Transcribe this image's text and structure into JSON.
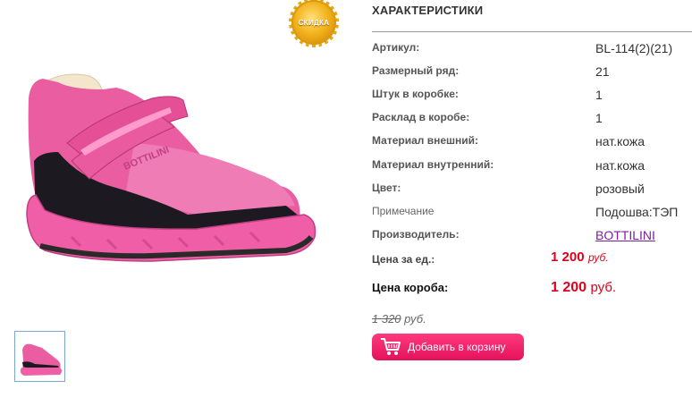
{
  "badge": {
    "label": "СКИДКА"
  },
  "specs": {
    "title": "ХАРАКТЕРИСТИКИ",
    "rows": [
      {
        "label": "Артикул:",
        "value": "BL-114(2)(21)"
      },
      {
        "label": "Размерный ряд:",
        "value": "21"
      },
      {
        "label": "Штук в коробке:",
        "value": "1"
      },
      {
        "label": "Расклад в коробе:",
        "value": "1"
      },
      {
        "label": "Материал внешний:",
        "value": "нат.кожа"
      },
      {
        "label": "Материал внутренний:",
        "value": "нат.кожа"
      },
      {
        "label": "Цвет:",
        "value": "розовый"
      },
      {
        "label": "Примечание",
        "value": "Подошва:ТЭП"
      },
      {
        "label": "Производитель:",
        "value": "BOTTILINI"
      }
    ]
  },
  "price": {
    "unit_label": "Цена за ед.:",
    "unit_value": "1 200",
    "unit_currency": "руб.",
    "box_label": "Цена короба:",
    "box_value": "1 200",
    "box_currency": "руб.",
    "old_value": "1 320",
    "old_currency": "руб."
  },
  "cart": {
    "label": "Добавить в корзину",
    "icon": "cart-icon"
  },
  "colors": {
    "accent": "#e3125b",
    "price": "#e0001b",
    "link": "#7a1fa0"
  }
}
